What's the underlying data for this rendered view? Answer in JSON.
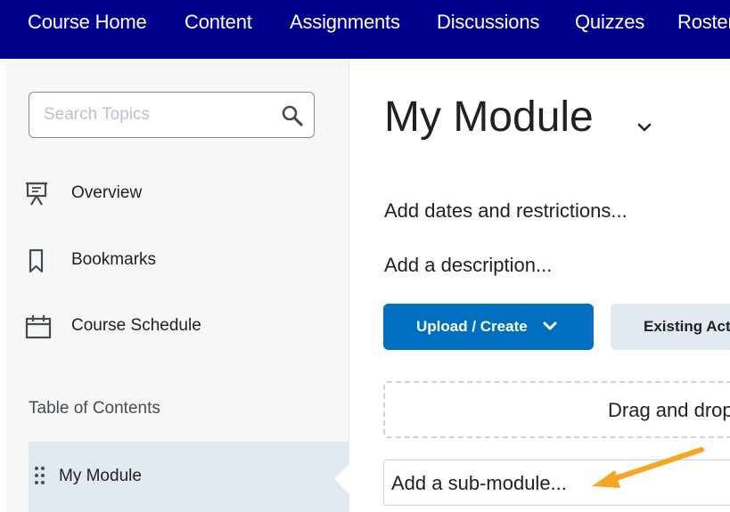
{
  "navbar": {
    "items": [
      "Course Home",
      "Content",
      "Assignments",
      "Discussions",
      "Quizzes",
      "Roster"
    ]
  },
  "sidebar": {
    "search_placeholder": "Search Topics",
    "links": [
      {
        "label": "Overview",
        "icon": "presentation-icon"
      },
      {
        "label": "Bookmarks",
        "icon": "bookmark-icon"
      },
      {
        "label": "Course Schedule",
        "icon": "calendar-icon"
      }
    ],
    "toc_heading": "Table of Contents",
    "toc_items": [
      {
        "label": "My Module",
        "selected": true
      }
    ]
  },
  "main": {
    "title": "My Module",
    "add_dates": "Add dates and restrictions...",
    "add_description": "Add a description...",
    "upload_button": "Upload / Create",
    "existing_button": "Existing Activities",
    "dropzone_text": "Drag and drop files here",
    "submodule_placeholder": "Add a sub-module..."
  },
  "colors": {
    "navbar": "#00008b",
    "primary": "#006fbf",
    "annotation_arrow": "#f6a623"
  }
}
